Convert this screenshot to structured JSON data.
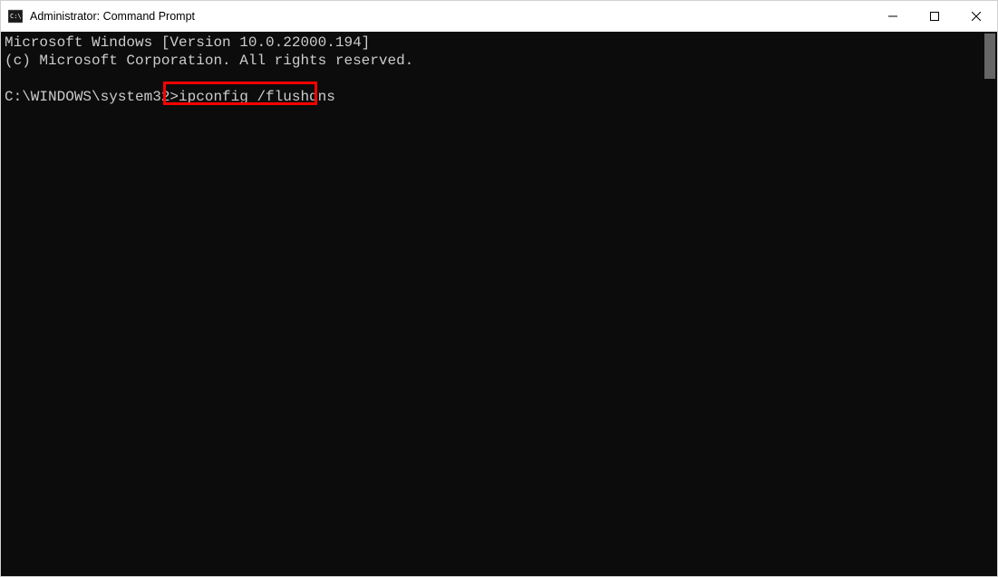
{
  "window": {
    "title": "Administrator: Command Prompt"
  },
  "terminal": {
    "line1": "Microsoft Windows [Version 10.0.22000.194]",
    "line2": "(c) Microsoft Corporation. All rights reserved.",
    "blank": "",
    "prompt": "C:\\WINDOWS\\system32>",
    "command": "ipconfig /flushdns"
  },
  "highlight": {
    "top": "55",
    "left": "179",
    "width": "170",
    "height": "26"
  }
}
